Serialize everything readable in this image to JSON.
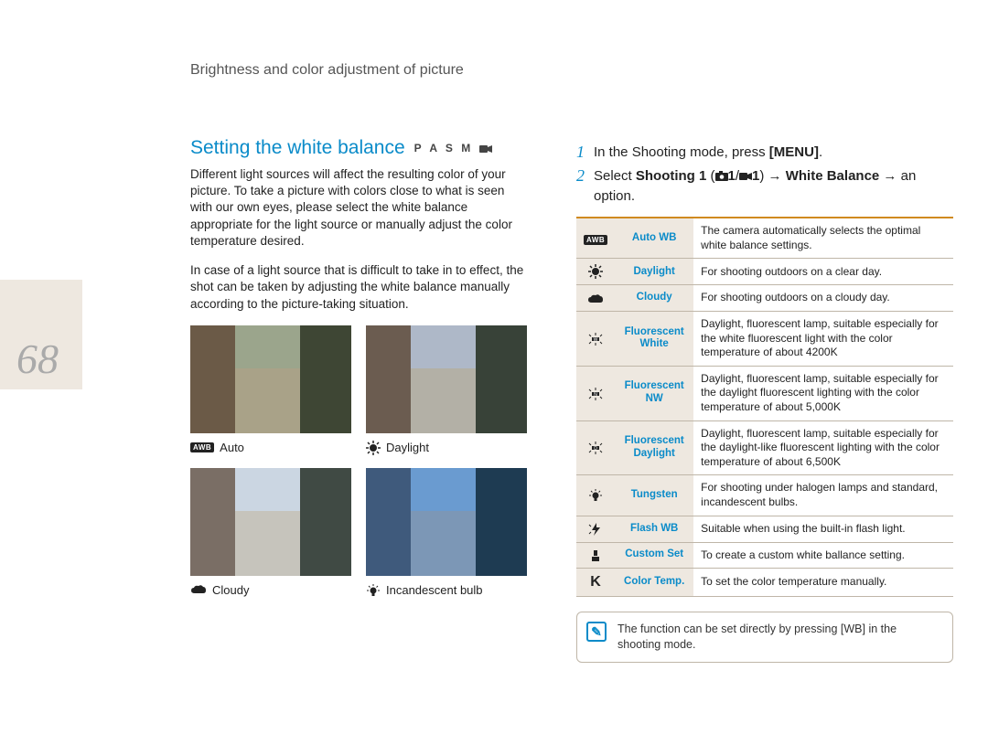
{
  "header": {
    "breadcrumb": "Brightness and color adjustment of picture"
  },
  "page_number": "68",
  "section": {
    "title": "Setting the white balance",
    "modes": "P A S M",
    "para1": "Different light sources will affect the resulting color of your picture. To take a picture with colors close to what is seen with our own eyes, please select the white balance appropriate for the light source or manually adjust the color temperature desired.",
    "para2": "In case of a light source that is difficult to take in to effect, the shot can be taken by adjusting the white balance manually according to the picture-taking situation."
  },
  "thumbs": {
    "auto": {
      "label": "Auto"
    },
    "daylight": {
      "label": "Daylight"
    },
    "cloudy": {
      "label": "Cloudy"
    },
    "incandescent": {
      "label": "Incandescent bulb"
    }
  },
  "steps": {
    "1": {
      "num": "1",
      "textA": "In the Shooting mode, press ",
      "bold": "[MENU]",
      "textB": "."
    },
    "2": {
      "num": "2",
      "textA": "Select ",
      "bold1": "Shooting 1",
      "textB": " (",
      "iconSuffix": "1",
      "textC": "/",
      "textD": "1",
      "textE": ") → ",
      "bold2": "White Balance",
      "textF": " → an option."
    }
  },
  "table": [
    {
      "icon": "awb",
      "name": "Auto WB",
      "desc": "The camera automatically selects the optimal white balance settings."
    },
    {
      "icon": "sun",
      "name": "Daylight",
      "desc": "For shooting outdoors on a clear day."
    },
    {
      "icon": "cloud",
      "name": "Cloudy",
      "desc": "For shooting outdoors on a cloudy day."
    },
    {
      "icon": "fl-w",
      "name": "Fluorescent White",
      "desc": "Daylight, fluorescent lamp, suitable especially for the white fluorescent light with the color temperature of about 4200K"
    },
    {
      "icon": "fl-n",
      "name": "Fluorescent NW",
      "desc": "Daylight, fluorescent lamp, suitable especially for the daylight fluorescent lighting with the color temperature of about 5,000K"
    },
    {
      "icon": "fl-d",
      "name": "Fluorescent Daylight",
      "desc": "Daylight, fluorescent lamp, suitable especially for the daylight-like fluorescent lighting with the color temperature of about 6,500K"
    },
    {
      "icon": "bulb",
      "name": "Tungsten",
      "desc": "For shooting under halogen lamps and standard, incandescent bulbs."
    },
    {
      "icon": "flash",
      "name": "Flash WB",
      "desc": "Suitable when using the built-in flash light."
    },
    {
      "icon": "custom",
      "name": "Custom Set",
      "desc": "To create a custom white ballance setting."
    },
    {
      "icon": "k",
      "name": "Color Temp.",
      "desc": "To set the color temperature manually."
    }
  ],
  "note": {
    "textA": "The function can be set directly by pressing ",
    "bold": "[WB]",
    "textB": " in the shooting mode."
  }
}
